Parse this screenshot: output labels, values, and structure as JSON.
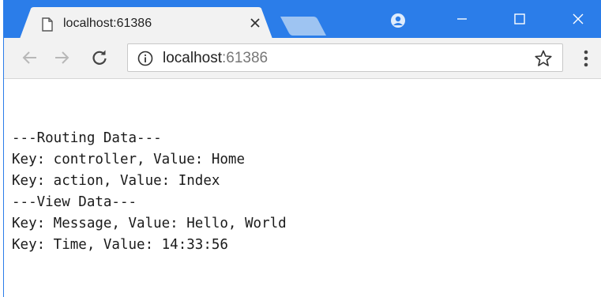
{
  "colors": {
    "titlebar": "#2b7de9",
    "toolbar": "#f2f2f2",
    "inactive_tab": "#9ec4f2"
  },
  "tab": {
    "title": "localhost:61386",
    "close_icon": "close-icon",
    "favicon": "page-icon"
  },
  "window_controls": {
    "profile": "profile-icon",
    "minimize": "minimize-icon",
    "maximize": "maximize-icon",
    "close": "close-icon"
  },
  "toolbar": {
    "back": "back-icon",
    "forward": "forward-icon",
    "reload": "reload-icon",
    "menu": "menu-icon"
  },
  "omnibox": {
    "host": "localhost",
    "port": ":61386",
    "info_icon": "info-icon",
    "star_icon": "star-icon"
  },
  "content": {
    "lines": [
      "---Routing Data---",
      "Key: controller, Value: Home",
      "Key: action, Value: Index",
      "---View Data---",
      "Key: Message, Value: Hello, World",
      "Key: Time, Value: 14:33:56"
    ]
  }
}
